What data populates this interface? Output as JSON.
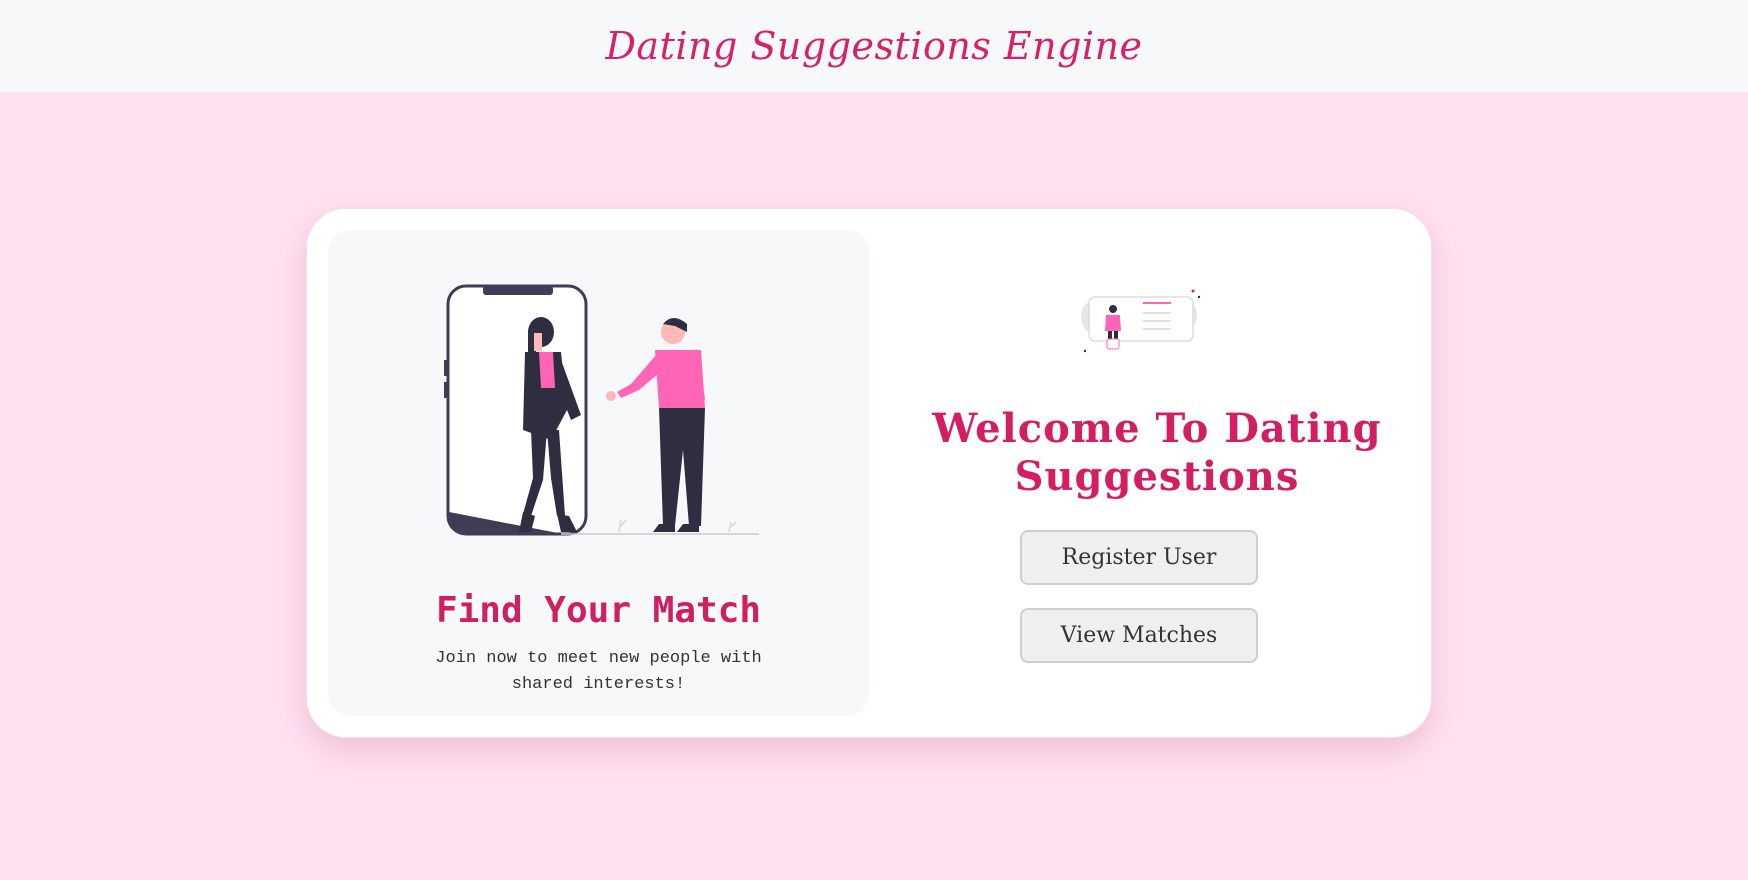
{
  "header": {
    "title": "Dating Suggestions Engine"
  },
  "left_panel": {
    "title": "Find Your Match",
    "subtitle": "Join now to meet new people with shared interests!",
    "illustration": "couple-phone-illustration"
  },
  "right_panel": {
    "illustration": "profile-card-illustration",
    "welcome": "Welcome To Dating Suggestions",
    "buttons": {
      "register": "Register User",
      "matches": "View Matches"
    }
  },
  "colors": {
    "accent": "#d31e63",
    "pink_figure": "#ff65b5",
    "dark_figure": "#2f2e41",
    "page_bg": "#ffe0f0"
  }
}
